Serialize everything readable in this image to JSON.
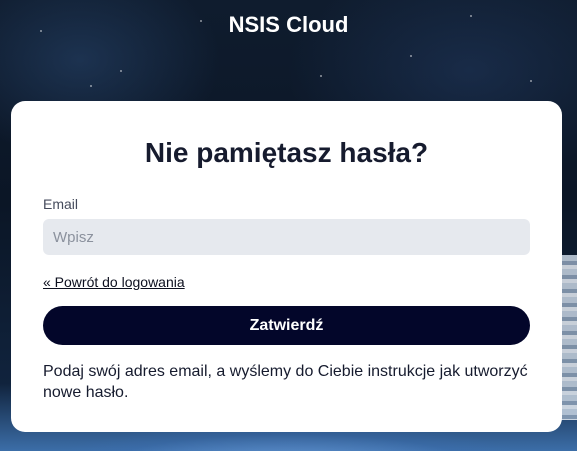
{
  "header": {
    "title": "NSIS Cloud"
  },
  "card": {
    "title": "Nie pamiętasz hasła?",
    "email_label": "Email",
    "email_placeholder": "Wpisz",
    "email_value": "",
    "back_link": "« Powrót do logowania",
    "submit_label": "Zatwierdź",
    "info_text": "Podaj swój adres email, a wyślemy do Ciebie instrukcje jak utworzyć nowe hasło."
  },
  "colors": {
    "button_bg": "#03062a",
    "card_bg": "#ffffff",
    "input_bg": "#e6e9ee",
    "title_text": "#161b2e"
  }
}
